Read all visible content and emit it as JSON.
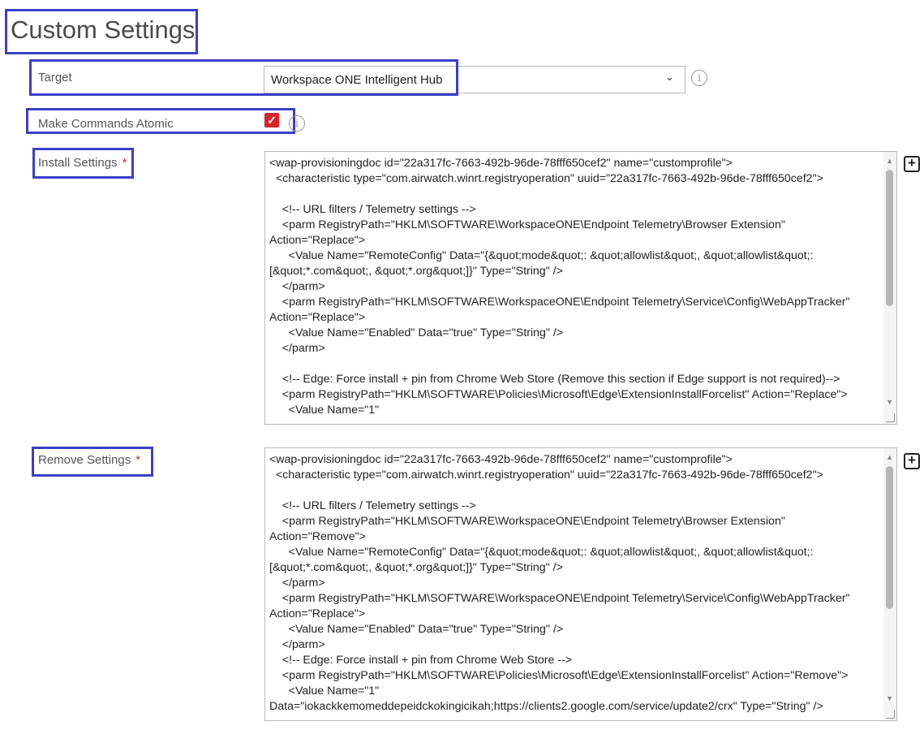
{
  "page": {
    "title": "Custom Settings"
  },
  "target": {
    "label": "Target",
    "value": "Workspace ONE Intelligent Hub"
  },
  "atomic": {
    "label": "Make Commands Atomic",
    "checked": true
  },
  "install": {
    "label": "Install Settings",
    "required_mark": "*",
    "code": "<wap-provisioningdoc id=\"22a317fc-7663-492b-96de-78fff650cef2\" name=\"customprofile\">\n  <characteristic type=\"com.airwatch.winrt.registryoperation\" uuid=\"22a317fc-7663-492b-96de-78fff650cef2\">\n\n    <!-- URL filters / Telemetry settings -->\n    <parm RegistryPath=\"HKLM\\SOFTWARE\\WorkspaceONE\\Endpoint Telemetry\\Browser Extension\" Action=\"Replace\">\n      <Value Name=\"RemoteConfig\" Data=\"{&quot;mode&quot;: &quot;allowlist&quot;, &quot;allowlist&quot;: [&quot;*.com&quot;, &quot;*.org&quot;]}\" Type=\"String\" />\n    </parm>\n    <parm RegistryPath=\"HKLM\\SOFTWARE\\WorkspaceONE\\Endpoint Telemetry\\Service\\Config\\WebAppTracker\" Action=\"Replace\">\n      <Value Name=\"Enabled\" Data=\"true\" Type=\"String\" />\n    </parm>\n\n    <!-- Edge: Force install + pin from Chrome Web Store (Remove this section if Edge support is not required)-->\n    <parm RegistryPath=\"HKLM\\SOFTWARE\\Policies\\Microsoft\\Edge\\ExtensionInstallForcelist\" Action=\"Replace\">\n      <Value Name=\"1\""
  },
  "remove": {
    "label": "Remove Settings",
    "required_mark": "*",
    "code": "<wap-provisioningdoc id=\"22a317fc-7663-492b-96de-78fff650cef2\" name=\"customprofile\">\n  <characteristic type=\"com.airwatch.winrt.registryoperation\" uuid=\"22a317fc-7663-492b-96de-78fff650cef2\">\n\n    <!-- URL filters / Telemetry settings -->\n    <parm RegistryPath=\"HKLM\\SOFTWARE\\WorkspaceONE\\Endpoint Telemetry\\Browser Extension\" Action=\"Remove\">\n      <Value Name=\"RemoteConfig\" Data=\"{&quot;mode&quot;: &quot;allowlist&quot;, &quot;allowlist&quot;: [&quot;*.com&quot;, &quot;*.org&quot;]}\" Type=\"String\" />\n    </parm>\n    <parm RegistryPath=\"HKLM\\SOFTWARE\\WorkspaceONE\\Endpoint Telemetry\\Service\\Config\\WebAppTracker\" Action=\"Replace\">\n      <Value Name=\"Enabled\" Data=\"true\" Type=\"String\" />\n    </parm>\n    <!-- Edge: Force install + pin from Chrome Web Store -->\n    <parm RegistryPath=\"HKLM\\SOFTWARE\\Policies\\Microsoft\\Edge\\ExtensionInstallForcelist\" Action=\"Remove\">\n      <Value Name=\"1\"\nData=\"iokackkemomeddepeidckokingicikah;https://clients2.google.com/service/update2/crx\" Type=\"String\" />"
  },
  "icons": {
    "info": "info-icon",
    "add": "plus-square-icon",
    "caret": "chevron-down-icon",
    "check": "checkmark-icon"
  },
  "colors": {
    "highlight": "#3b3fc7",
    "required": "#d7262b",
    "checkbox": "#d7262b"
  }
}
